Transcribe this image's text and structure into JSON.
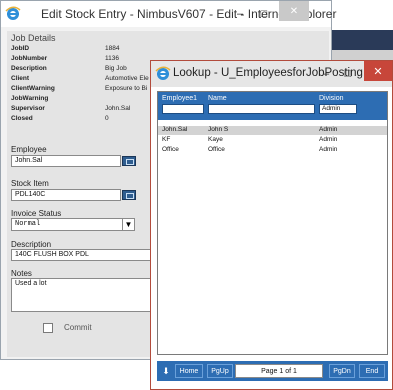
{
  "main_window": {
    "title": "Edit Stock Entry - NimbusV607 - Edit - Internet Explorer",
    "minimize": "–",
    "maximize": "□",
    "close": "✕"
  },
  "job_details": {
    "section": "Job Details",
    "rows": [
      {
        "key": "JobID",
        "value": "1884"
      },
      {
        "key": "JobNumber",
        "value": "1136"
      },
      {
        "key": "Description",
        "value": "Big Job"
      },
      {
        "key": "Client",
        "value": "Automotive Ele"
      },
      {
        "key": "ClientWarning",
        "value": "Exposure to Bi"
      },
      {
        "key": "JobWarning",
        "value": ""
      },
      {
        "key": "Supervisor",
        "value": "John.Sal"
      },
      {
        "key": "Closed",
        "value": "0"
      }
    ]
  },
  "form": {
    "employee_label": "Employee",
    "employee_value": "John.Sal",
    "stock_label": "Stock Item",
    "stock_value": "PDL140C",
    "status_label": "Invoice Status",
    "status_value": "Normal",
    "description_label": "Description",
    "description_value": "140C FLUSH BOX PDL",
    "notes_label": "Notes",
    "notes_value": "Used a lot",
    "commit_label": "Commit"
  },
  "lookup": {
    "title": "Lookup - U_EmployeesforJobPosting - Int...",
    "minimize": "–",
    "maximize": "□",
    "close": "✕",
    "columns": [
      "Employee1",
      "Name",
      "Division"
    ],
    "filter_division": "Admin",
    "rows": [
      {
        "employee": "John.Sal",
        "name": "John S",
        "division": "Admin"
      },
      {
        "employee": "KF",
        "name": "Kaye",
        "division": "Admin"
      },
      {
        "employee": "Office",
        "name": "Office",
        "division": "Admin"
      }
    ],
    "footer": {
      "home": "Home",
      "pgup": "PgUp",
      "page": "Page 1 of 1",
      "pgdn": "PgDn",
      "end": "End"
    }
  }
}
